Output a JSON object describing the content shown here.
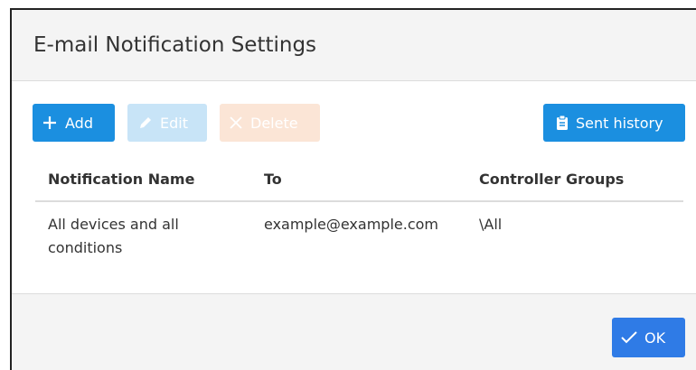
{
  "dialog": {
    "title": "E-mail Notification Settings"
  },
  "toolbar": {
    "add_label": "Add",
    "edit_label": "Edit",
    "delete_label": "Delete",
    "history_label": "Sent history"
  },
  "table": {
    "headers": [
      "Notification Name",
      "To",
      "Controller Groups"
    ],
    "rows": [
      [
        "All devices and all conditions",
        "example@example.com",
        "\\All"
      ]
    ]
  },
  "footer": {
    "ok_label": "OK"
  },
  "colors": {
    "primary": "#1b8fe0",
    "ok": "#2f7be6",
    "disabled_edit": "#c8e4f7",
    "disabled_delete": "#fbe5d6"
  }
}
